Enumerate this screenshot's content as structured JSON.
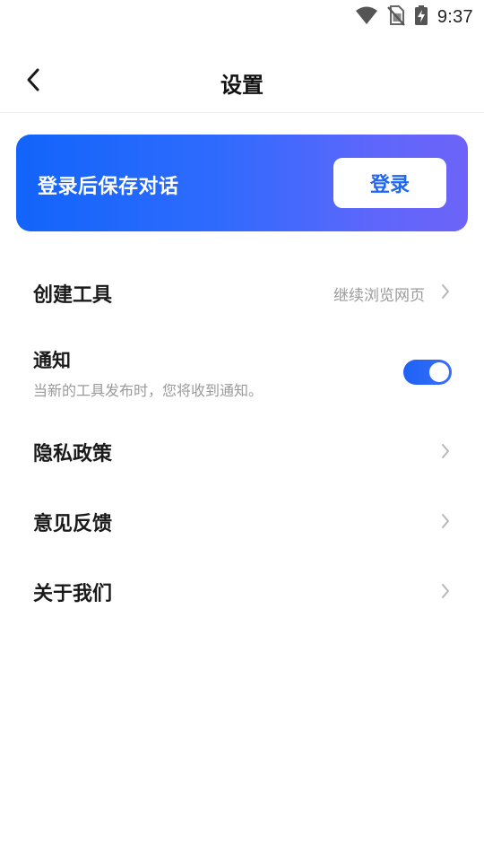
{
  "status_bar": {
    "time": "9:37",
    "icons": [
      "wifi-icon",
      "no-sim-icon",
      "battery-charging-icon"
    ]
  },
  "header": {
    "title": "设置",
    "back_icon": "chevron-left-icon"
  },
  "banner": {
    "text": "登录后保存对话",
    "button_label": "登录",
    "gradient_start": "#1264fa",
    "gradient_end": "#6d63f8"
  },
  "settings": {
    "create_tools": {
      "label": "创建工具",
      "value": "继续浏览网页"
    },
    "notifications": {
      "label": "通知",
      "description": "当新的工具发布时，您将收到通知。",
      "enabled": true
    },
    "privacy": {
      "label": "隐私政策"
    },
    "feedback": {
      "label": "意见反馈"
    },
    "about": {
      "label": "关于我们"
    }
  },
  "colors": {
    "accent": "#1f67f2",
    "secondary_text": "#9a9a9a",
    "chevron": "#b8b8b8"
  }
}
